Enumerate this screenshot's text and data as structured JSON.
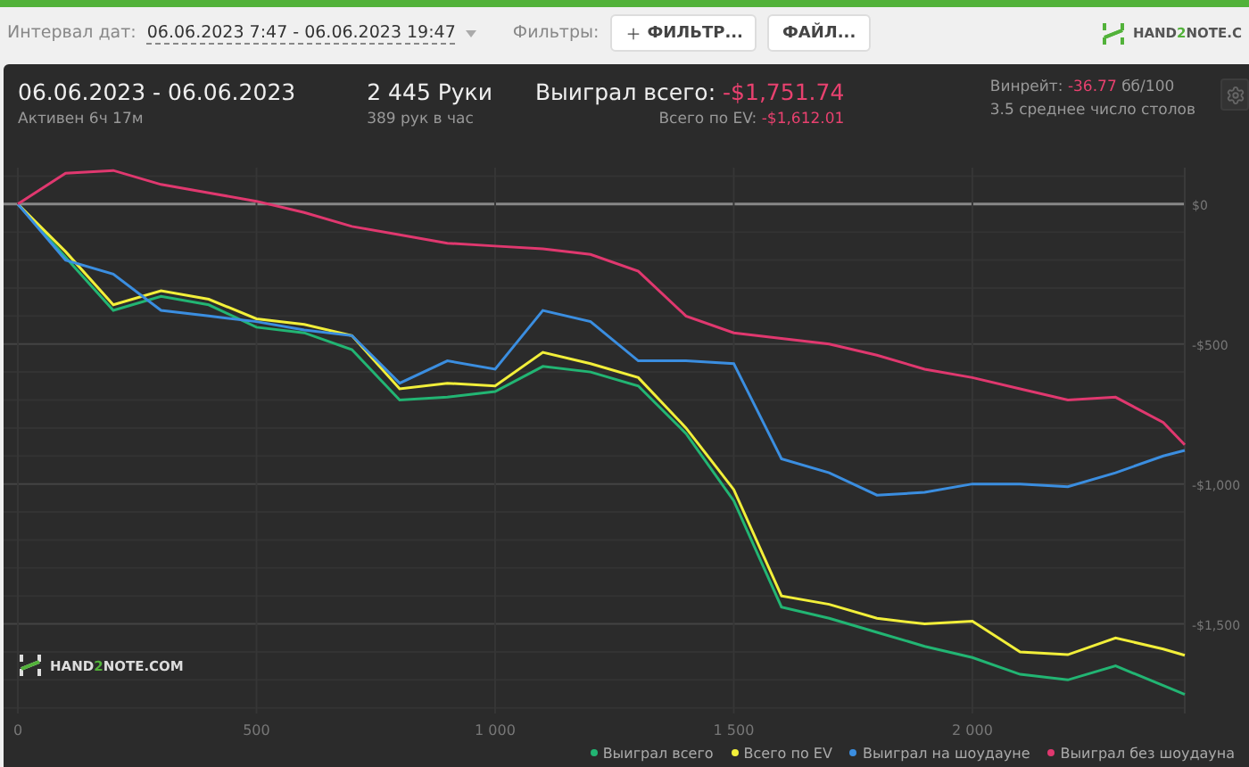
{
  "toolbar": {
    "date_label": "Интервал дат:",
    "date_value": "06.06.2023 7:47 - 06.06.2023 19:47",
    "filters_label": "Фильтры:",
    "buttons": [
      {
        "label": "ФИЛЬТР...",
        "kind": "add"
      },
      {
        "label": "ФАЙЛ...",
        "kind": "plain"
      }
    ],
    "logo": {
      "before": "HAND",
      "accent": "2",
      "after": "NOTE.C"
    }
  },
  "summary": {
    "period": "06.06.2023 - 06.06.2023",
    "active": "Активен 6ч 17м",
    "hands": "2 445 Руки",
    "hands_rate": "389 рук в час",
    "won_label": "Выиграл всего:",
    "won_value": "-$1,751.74",
    "ev_label": "Всего по EV:",
    "ev_value": "-$1,612.01",
    "winrate_label": "Винрейт:",
    "winrate_value": "-36.77",
    "winrate_unit": "бб/100",
    "tables": "3.5 среднее число столов"
  },
  "chart": {
    "watermark": {
      "before": "HAND",
      "accent": "2",
      "after": "NOTE.COM"
    },
    "chart_data": {
      "type": "line",
      "grid": true,
      "x": [
        0,
        100,
        200,
        300,
        400,
        500,
        600,
        700,
        800,
        900,
        1000,
        1100,
        1200,
        1300,
        1400,
        1500,
        1600,
        1700,
        1800,
        1900,
        2000,
        2100,
        2200,
        2300,
        2400,
        2445
      ],
      "xlim": [
        0,
        2445
      ],
      "ylim": [
        -1820,
        130
      ],
      "xticks": [
        {
          "value": 0,
          "label": "0"
        },
        {
          "value": 500,
          "label": "500"
        },
        {
          "value": 1000,
          "label": "1 000"
        },
        {
          "value": 1500,
          "label": "1 500"
        },
        {
          "value": 2000,
          "label": "2 000"
        }
      ],
      "yticks": [
        {
          "value": 0,
          "label": "$0"
        },
        {
          "value": -500,
          "label": "-$500"
        },
        {
          "value": -1000,
          "label": "-$1,000"
        },
        {
          "value": -1500,
          "label": "-$1,500"
        }
      ],
      "series": [
        {
          "name": "Выиграл всего",
          "color": "#22b573",
          "values": [
            0,
            -190,
            -380,
            -330,
            -360,
            -440,
            -460,
            -520,
            -700,
            -690,
            -670,
            -580,
            -600,
            -650,
            -820,
            -1060,
            -1440,
            -1480,
            -1530,
            -1580,
            -1620,
            -1680,
            -1700,
            -1650,
            -1720,
            -1752
          ]
        },
        {
          "name": "Всего по EV",
          "color": "#f2ef3a",
          "values": [
            0,
            -170,
            -360,
            -310,
            -340,
            -410,
            -430,
            -470,
            -660,
            -640,
            -650,
            -530,
            -570,
            -620,
            -800,
            -1020,
            -1400,
            -1430,
            -1480,
            -1500,
            -1490,
            -1600,
            -1610,
            -1550,
            -1590,
            -1612
          ]
        },
        {
          "name": "Выиграл на шоудауне",
          "color": "#3b8ee0",
          "values": [
            0,
            -200,
            -250,
            -380,
            -400,
            -420,
            -450,
            -470,
            -640,
            -560,
            -590,
            -380,
            -420,
            -560,
            -560,
            -570,
            -910,
            -960,
            -1040,
            -1030,
            -1000,
            -1000,
            -1010,
            -960,
            -900,
            -880
          ]
        },
        {
          "name": "Выиграл без шоудауна",
          "color": "#e0386f",
          "values": [
            0,
            110,
            120,
            70,
            40,
            10,
            -30,
            -80,
            -110,
            -140,
            -150,
            -160,
            -180,
            -240,
            -400,
            -460,
            -480,
            -500,
            -540,
            -590,
            -620,
            -660,
            -700,
            -690,
            -780,
            -860
          ]
        }
      ]
    }
  }
}
